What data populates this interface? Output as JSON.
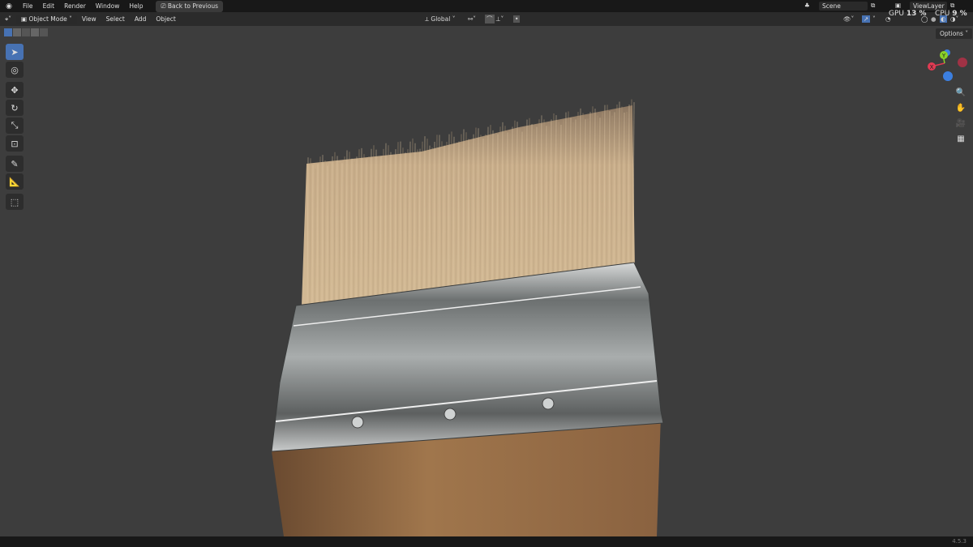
{
  "menu": {
    "items": [
      "File",
      "Edit",
      "Render",
      "Window",
      "Help"
    ],
    "back_label": "Back to Previous"
  },
  "header": {
    "mode": "Object Mode",
    "items": [
      "View",
      "Select",
      "Add",
      "Object"
    ],
    "transform_orientation": "Global",
    "options_label": "Options"
  },
  "scene": {
    "scene_name": "Scene",
    "view_layer": "ViewLayer"
  },
  "stats": {
    "gpu_label": "GPU",
    "gpu_value": "13 %",
    "cpu_label": "CPU",
    "cpu_value": "9 %"
  },
  "gizmo": {
    "x": "X",
    "y": "Y",
    "colors": {
      "x": "#e23b53",
      "y": "#8bd128",
      "z": "#3c7fe0"
    }
  },
  "toolbar": {
    "tools": [
      "select-box",
      "cursor",
      "move",
      "rotate",
      "scale",
      "transform",
      "annotate",
      "measure",
      "add-cube"
    ],
    "active": "select-box"
  },
  "viewport": {
    "background": "#3d3d3d",
    "object": "paint brush"
  },
  "status": {
    "version": "4.5.3"
  },
  "colors": {
    "accent": "#4772b3"
  }
}
